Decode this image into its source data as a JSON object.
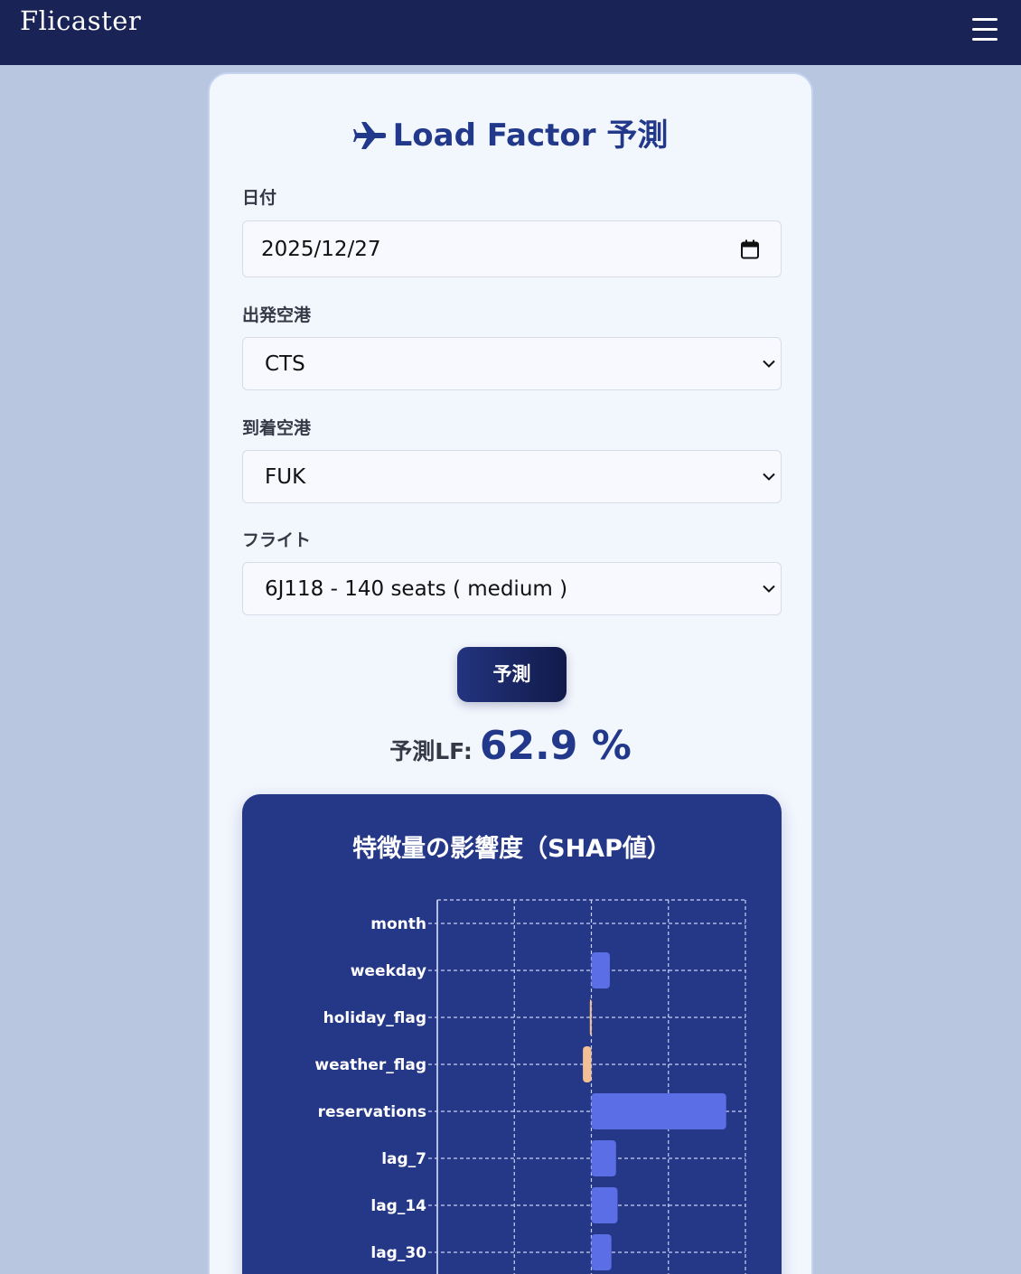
{
  "header": {
    "logo": "Flicaster",
    "menu_icon": "hamburger-menu-icon"
  },
  "form": {
    "title": "Load Factor 予測",
    "title_icon": "airplane-icon",
    "date": {
      "label": "日付",
      "value": "2025/12/27",
      "icon": "calendar-icon"
    },
    "departure": {
      "label": "出発空港",
      "value": "CTS"
    },
    "arrival": {
      "label": "到着空港",
      "value": "FUK"
    },
    "flight": {
      "label": "フライト",
      "value": "6J118 - 140 seats ( medium )"
    },
    "predict_button": "予測"
  },
  "result": {
    "label": "予測LF:",
    "value": "62.9 %"
  },
  "colors": {
    "navbar": "#1a2355",
    "page_background": "#b8c6e0",
    "accent": "#22398b",
    "chart_background": "#253787",
    "positive_bar": "#5b6ee6",
    "negative_bar": "#f3c095"
  },
  "chart_data": {
    "type": "bar",
    "orientation": "horizontal",
    "title": "特徴量の影響度（SHAP値）",
    "categories": [
      "month",
      "weekday",
      "holiday_flag",
      "weather_flag",
      "reservations",
      "lag_7",
      "lag_14",
      "lag_30"
    ],
    "values": [
      0.0,
      0.024,
      -0.002,
      -0.011,
      0.175,
      0.032,
      0.034,
      0.026
    ],
    "xlim": [
      -0.2,
      0.2
    ],
    "grid": true
  }
}
